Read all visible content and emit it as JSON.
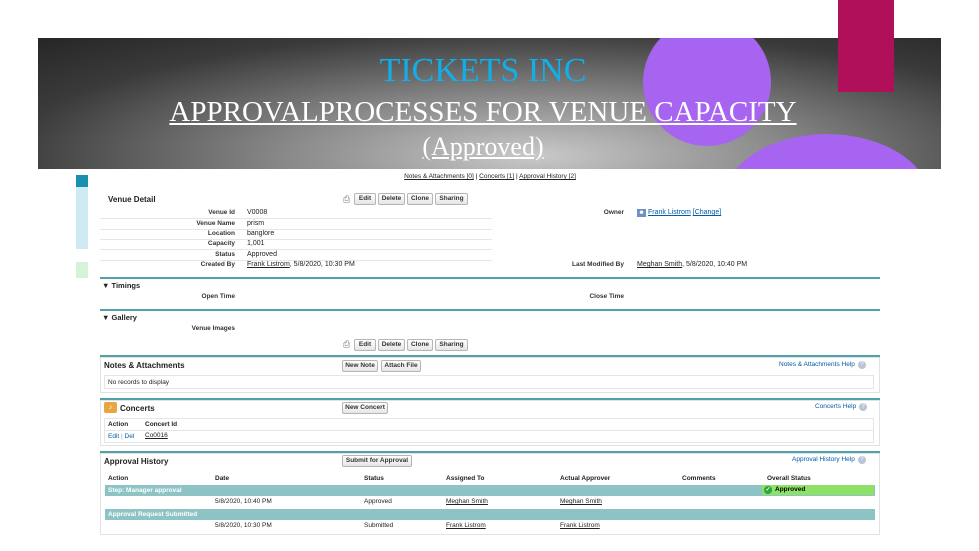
{
  "slide": {
    "title": "TICKETS INC",
    "subtitle": "APPROVALPROCESSES FOR VENUE CAPACITY",
    "status_line": "(Approved)"
  },
  "top_links": [
    "Notes & Attachments [0]",
    "Concerts [1]",
    "Approval History [2]"
  ],
  "venue_detail": {
    "header": "Venue Detail",
    "buttons": [
      "Edit",
      "Delete",
      "Clone",
      "Sharing"
    ],
    "fields": {
      "venue_id_label": "Venue Id",
      "venue_id": "V0008",
      "venue_name_label": "Venue Name",
      "venue_name": "prism",
      "location_label": "Location",
      "location": "banglore",
      "capacity_label": "Capacity",
      "capacity": "1,001",
      "status_label": "Status",
      "status": "Approved",
      "created_by_label": "Created By",
      "created_by_name": "Frank Listrom",
      "created_by_date": ", 5/8/2020, 10:30 PM",
      "owner_label": "Owner",
      "owner_name": "Frank Listrom",
      "owner_change": "[Change]",
      "modified_label": "Last Modified By",
      "modified_name": "Meghan Smith",
      "modified_date": ", 5/8/2020, 10:40 PM"
    }
  },
  "timings": {
    "header": "Timings",
    "open_label": "Open Time",
    "close_label": "Close Time"
  },
  "gallery": {
    "header": "Gallery",
    "images_label": "Venue Images"
  },
  "notes": {
    "header": "Notes & Attachments",
    "new_note": "New Note",
    "attach_file": "Attach File",
    "help": "Notes & Attachments Help",
    "empty": "No records to display"
  },
  "concerts": {
    "header": "Concerts",
    "new_button": "New Concert",
    "help": "Concerts Help",
    "columns": [
      "Action",
      "Concert Id"
    ],
    "row": {
      "edit": "Edit",
      "sep": "|",
      "del": "Del",
      "id": "Co0016"
    }
  },
  "approval": {
    "header": "Approval History",
    "submit_button": "Submit for Approval",
    "help": "Approval History Help",
    "columns": [
      "Action",
      "Date",
      "Status",
      "Assigned To",
      "Actual Approver",
      "Comments",
      "Overall Status"
    ],
    "step1": "Step: Manager approval",
    "overall": "Approved",
    "row1": {
      "date": "5/8/2020, 10:40 PM",
      "status": "Approved",
      "assigned": "Meghan Smith",
      "approver": "Meghan Smith"
    },
    "step2": "Approval Request Submitted",
    "row2": {
      "date": "5/8/2020, 10:30 PM",
      "status": "Submitted",
      "assigned": "Frank Listrom",
      "approver": "Frank Listrom"
    }
  },
  "colors": {
    "teal": "#4fa3a8",
    "purple": "#a664f0",
    "magenta": "#b0105a",
    "title_blue": "#12aee8"
  }
}
